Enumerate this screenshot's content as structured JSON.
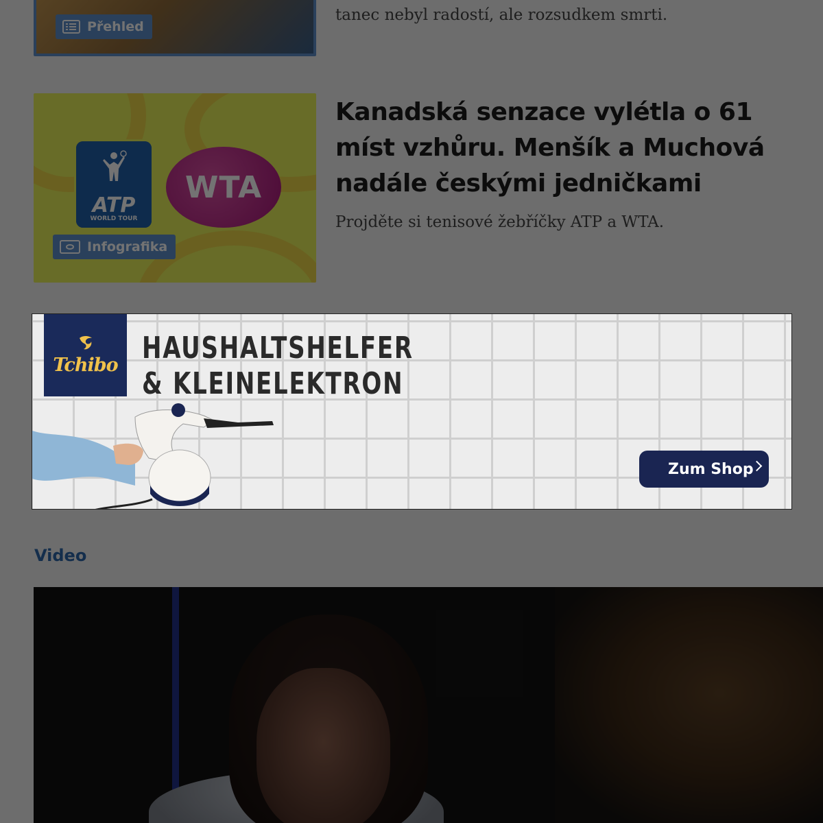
{
  "articles": [
    {
      "title": "",
      "perex": "tanec nebyl radostí, ale rozsudkem smrti.",
      "badge": "Přehled",
      "badge_icon": "list-icon"
    },
    {
      "title": "Kanadská senzace vylétla o 61 míst vzhůru. Menšík a Muchová nadále českými jedničkami",
      "perex": "Projděte si tenisové žebříčky ATP a WTA.",
      "badge": "Infografika",
      "badge_icon": "eye-icon",
      "logos": {
        "atp": "ATP",
        "atp_sub": "WORLD TOUR",
        "wta": "WTA"
      }
    }
  ],
  "ad": {
    "brand": "Tchibo",
    "headline_line1": "HAUSHALTSHELFER",
    "headline_line2": "& KLEINELEKTRON",
    "cta": "Zum Shop",
    "brand_color": "#1a2a5a",
    "accent_color": "#f0c14b"
  },
  "video_section": {
    "label": "Video"
  },
  "colors": {
    "badge_blue": "#5d8fc9",
    "section_blue": "#2e66a8"
  }
}
